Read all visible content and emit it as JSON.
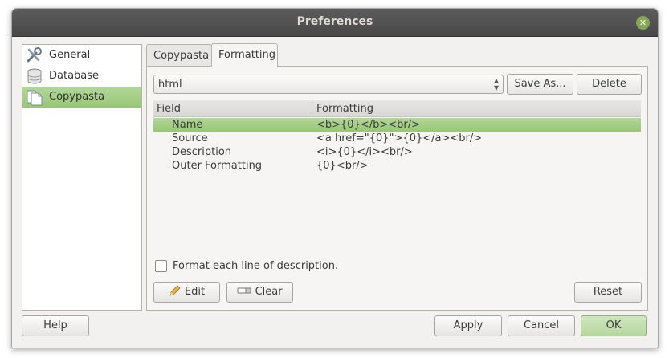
{
  "window": {
    "title": "Preferences",
    "close_icon": "close-icon"
  },
  "sidebar": {
    "items": [
      {
        "label": "General",
        "icon": "tools-icon",
        "selected": false
      },
      {
        "label": "Database",
        "icon": "database-icon",
        "selected": false
      },
      {
        "label": "Copypasta",
        "icon": "documents-icon",
        "selected": true
      }
    ]
  },
  "tabs": [
    {
      "label": "Copypasta",
      "active": false
    },
    {
      "label": "Formatting",
      "active": true
    }
  ],
  "formatting": {
    "preset_value": "html",
    "save_as_label": "Save As...",
    "delete_label": "Delete",
    "columns": [
      "Field",
      "Formatting"
    ],
    "rows": [
      {
        "field": "Name",
        "formatting": "<b>{0}</b><br/>",
        "selected": true
      },
      {
        "field": "Source",
        "formatting": "<a href=\"{0}\">{0}</a><br/>",
        "selected": false
      },
      {
        "field": "Description",
        "formatting": "<i>{0}</i><br/>",
        "selected": false
      },
      {
        "field": "Outer Formatting",
        "formatting": "{0}<br/>",
        "selected": false
      }
    ],
    "format_each_line_label": "Format each line of description.",
    "format_each_line_checked": false,
    "edit_label": "Edit",
    "clear_label": "Clear",
    "reset_label": "Reset"
  },
  "footer": {
    "help_label": "Help",
    "apply_label": "Apply",
    "cancel_label": "Cancel",
    "ok_label": "OK"
  },
  "colors": {
    "selection": "#a6d087",
    "titlebar": "#4f4f4f",
    "close": "#87a556"
  }
}
